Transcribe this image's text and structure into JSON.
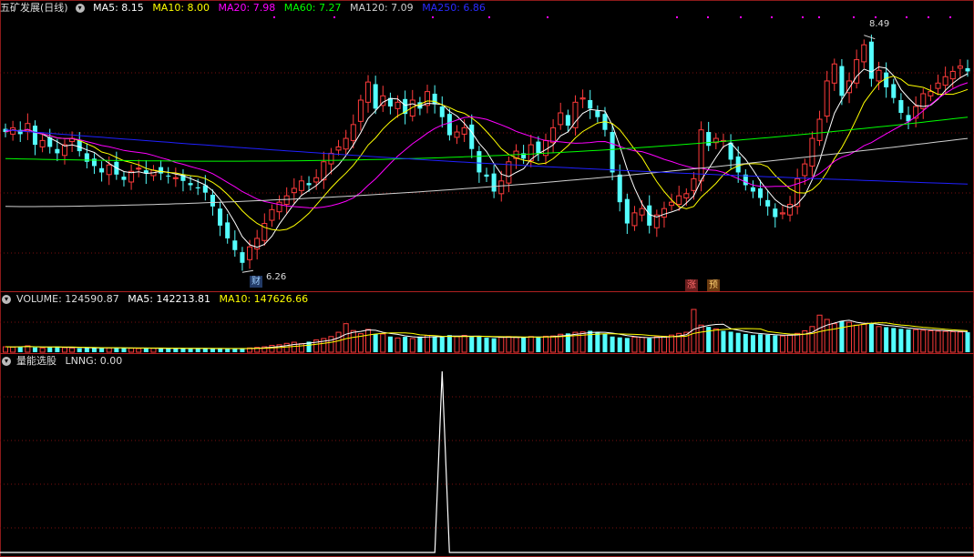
{
  "colors": {
    "up": "#ff3b3b",
    "down": "#54ffff",
    "ma5": "#ffffff",
    "ma10": "#ffff00",
    "ma20": "#ff00ff",
    "ma60": "#00ff00",
    "ma120": "#d0d0d0",
    "ma250": "#2020ff",
    "lnng": "#ffffff"
  },
  "price_header": {
    "title": "五矿发展(日线)",
    "ma5": "MA5: 8.15",
    "ma10": "MA10: 8.00",
    "ma20": "MA20: 7.98",
    "ma60": "MA60: 7.27",
    "ma120": "MA120: 7.09",
    "ma250": "MA250: 6.86"
  },
  "volume_header": {
    "volume": "VOLUME: 124590.87",
    "ma5": "MA5: 142213.81",
    "ma10": "MA10: 147626.66"
  },
  "indicator_header": {
    "name": "量能选股",
    "lnng": "LNNG: 0.00"
  },
  "annotations": {
    "low": "6.26",
    "high": "8.49",
    "tag_cai": "财",
    "tag_zhang": "涨",
    "tag_yu": "预"
  },
  "icons": {
    "header_toggle": "chevron-down-icon"
  },
  "chart_data": [
    {
      "type": "candlestick",
      "title": "五矿发展(日线)",
      "ylim": [
        6.1,
        8.65
      ],
      "low_label": 6.26,
      "high_label": 8.49,
      "closes": [
        7.58,
        7.62,
        7.56,
        7.66,
        7.46,
        7.5,
        7.44,
        7.38,
        7.46,
        7.52,
        7.4,
        7.3,
        7.26,
        7.2,
        7.27,
        7.18,
        7.13,
        7.21,
        7.24,
        7.19,
        7.22,
        7.19,
        7.17,
        7.15,
        7.12,
        7.08,
        7.05,
        7.01,
        6.88,
        6.7,
        6.58,
        6.47,
        6.35,
        6.5,
        6.58,
        6.72,
        6.85,
        6.92,
        6.98,
        7.05,
        7.12,
        7.08,
        7.15,
        7.3,
        7.38,
        7.44,
        7.52,
        7.65,
        7.88,
        8.05,
        7.8,
        7.92,
        7.82,
        7.86,
        7.75,
        7.88,
        7.8,
        7.96,
        7.84,
        7.72,
        7.55,
        7.58,
        7.62,
        7.42,
        7.2,
        7.16,
        7.02,
        7.12,
        7.3,
        7.4,
        7.33,
        7.46,
        7.38,
        7.5,
        7.62,
        7.76,
        7.64,
        7.86,
        7.9,
        7.8,
        7.72,
        7.6,
        7.2,
        6.92,
        6.72,
        6.82,
        6.86,
        6.7,
        6.8,
        6.86,
        6.92,
        6.98,
        7.0,
        7.14,
        7.6,
        7.45,
        7.52,
        7.5,
        7.32,
        7.2,
        7.08,
        7.02,
        6.96,
        6.88,
        6.78,
        6.82,
        6.9,
        7.14,
        7.28,
        7.52,
        7.7,
        8.06,
        8.22,
        7.92,
        8.06,
        8.26,
        8.4,
        8.08,
        8.16,
        8.0,
        7.9,
        7.76,
        7.68,
        7.82,
        7.94,
        7.96,
        8.04,
        8.1,
        8.15,
        8.2,
        8.15
      ],
      "ma_lines": {
        "MA60": {
          "start": 7.33,
          "end": 7.72
        },
        "MA120": {
          "start": 6.88,
          "end": 7.52
        },
        "MA250": {
          "start": 7.6,
          "end": 7.09
        }
      }
    },
    {
      "type": "bar",
      "title": "VOLUME",
      "values": [
        38,
        36,
        40,
        45,
        34,
        30,
        36,
        40,
        32,
        30,
        28,
        30,
        34,
        28,
        30,
        32,
        30,
        28,
        26,
        30,
        28,
        26,
        28,
        30,
        26,
        24,
        26,
        28,
        24,
        26,
        24,
        26,
        26,
        30,
        34,
        38,
        48,
        52,
        62,
        70,
        60,
        74,
        86,
        96,
        110,
        140,
        200,
        152,
        130,
        160,
        128,
        128,
        110,
        100,
        108,
        96,
        110,
        118,
        112,
        106,
        120,
        110,
        118,
        108,
        112,
        102,
        98,
        104,
        110,
        104,
        104,
        110,
        108,
        112,
        114,
        126,
        132,
        140,
        142,
        150,
        138,
        130,
        110,
        104,
        100,
        106,
        104,
        98,
        108,
        112,
        120,
        132,
        140,
        300,
        190,
        178,
        164,
        150,
        144,
        136,
        128,
        120,
        126,
        122,
        118,
        114,
        120,
        132,
        150,
        180,
        260,
        230,
        200,
        220,
        210,
        190,
        196,
        200,
        180,
        176,
        170,
        164,
        160,
        158,
        154,
        150,
        148,
        146,
        144,
        142,
        140
      ],
      "ma5": 142213.81,
      "ma10": 147626.66,
      "current": 124590.87
    },
    {
      "type": "line",
      "title": "量能选股",
      "spike_index": 59,
      "current": 0.0
    }
  ]
}
